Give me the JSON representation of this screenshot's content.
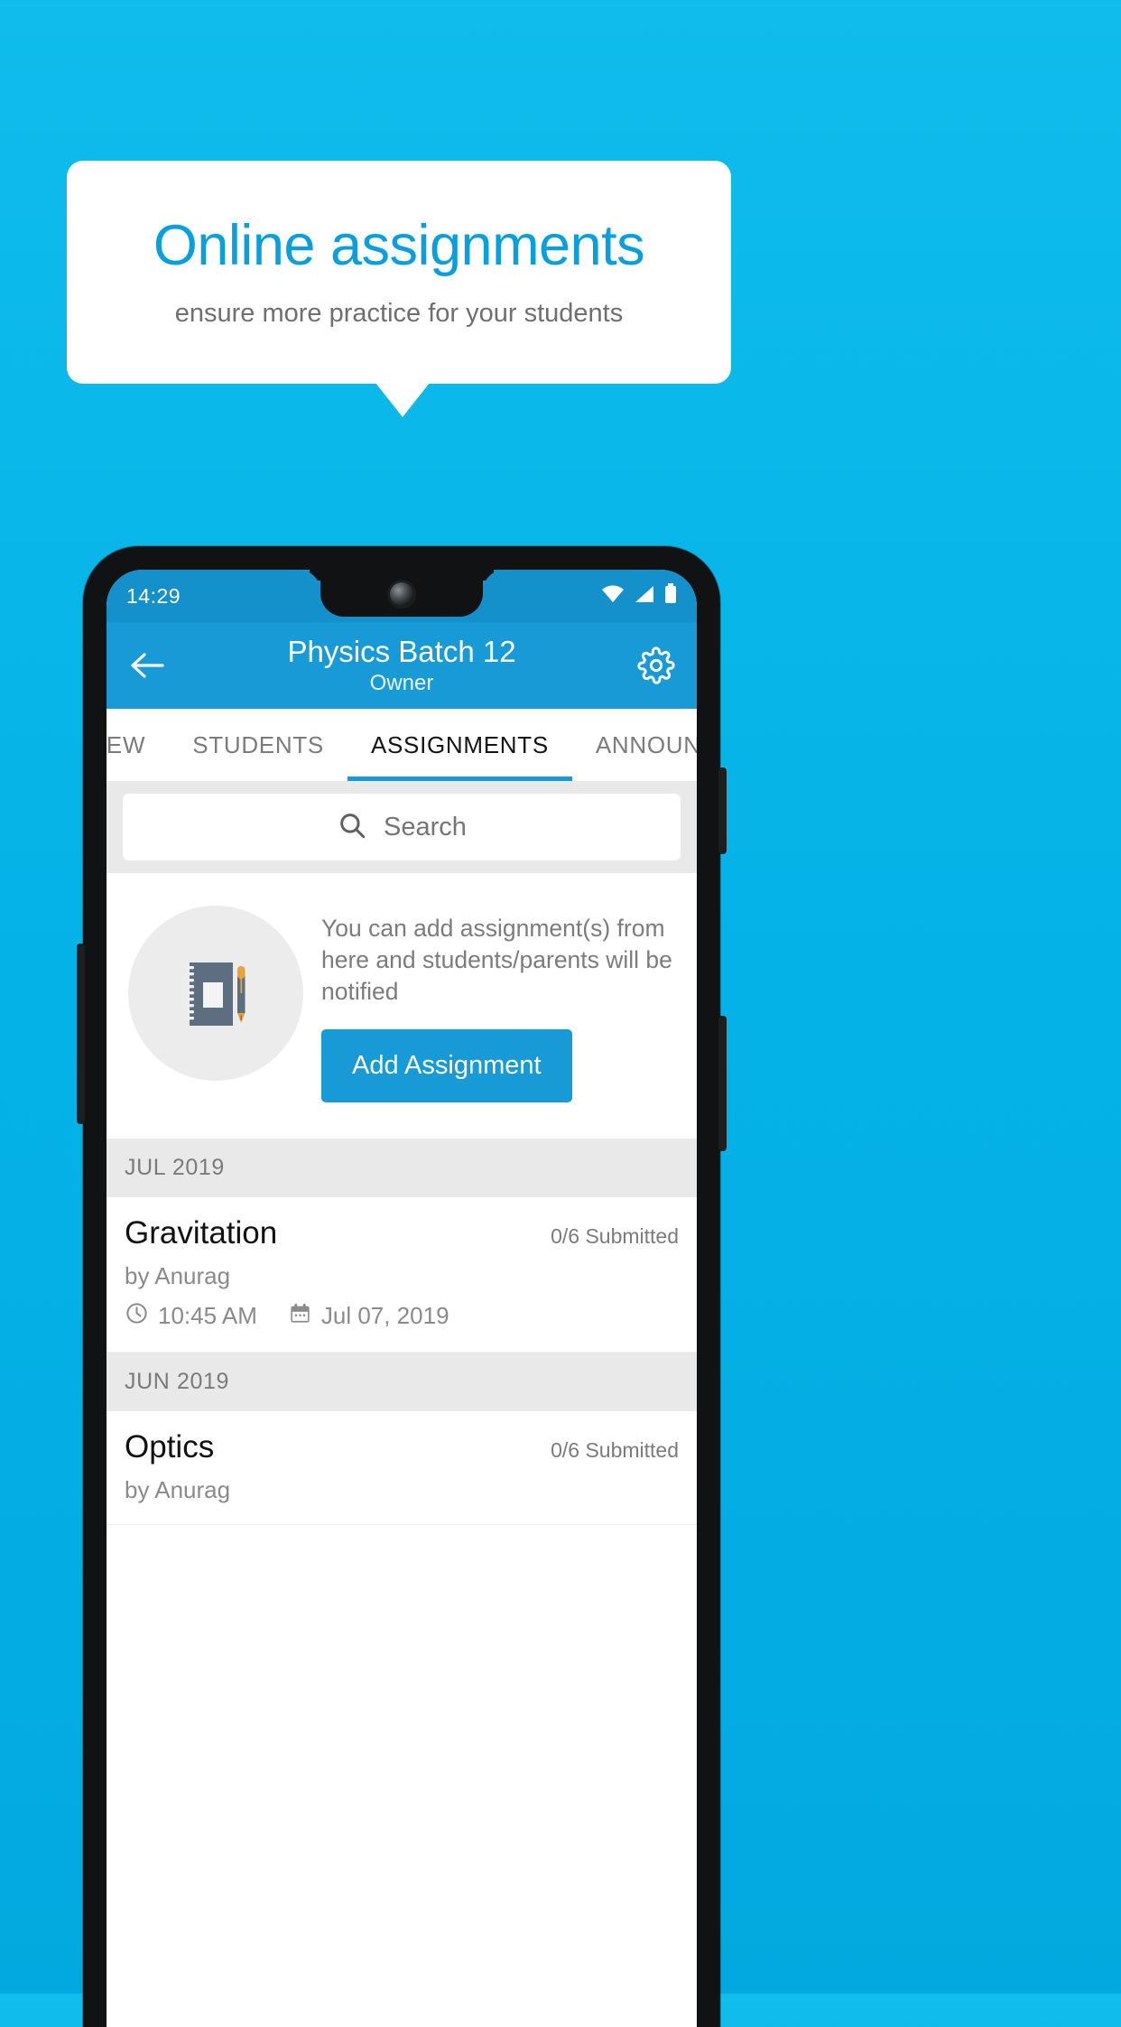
{
  "promo": {
    "title": "Online assignments",
    "subtitle": "ensure more practice for your students",
    "title_color": "#089fdd",
    "subtitle_color": "#6f6f6f",
    "background_color": "#05b3e8"
  },
  "statusbar": {
    "time": "14:29",
    "icons": [
      "wifi-icon",
      "signal-icon",
      "battery-icon"
    ]
  },
  "appbar": {
    "back_icon": "arrow-left-icon",
    "title": "Physics Batch 12",
    "subtitle": "Owner",
    "settings_icon": "gear-icon",
    "color": "#189ad6"
  },
  "tabs": [
    {
      "label": "IEW",
      "active": false
    },
    {
      "label": "STUDENTS",
      "active": false
    },
    {
      "label": "ASSIGNMENTS",
      "active": true
    },
    {
      "label": "ANNOUNCEM",
      "active": false
    }
  ],
  "search": {
    "placeholder": "Search",
    "value": "",
    "icon": "search-icon"
  },
  "empty_state": {
    "illustration": "notebook-pen-icon",
    "message": "You can add assignment(s) from here and students/parents will be notified",
    "button_label": "Add Assignment"
  },
  "assignment_groups": [
    {
      "month": "JUL 2019",
      "items": [
        {
          "title": "Gravitation",
          "submitted": "0/6 Submitted",
          "author": "by Anurag",
          "time": "10:45 AM",
          "date": "Jul 07, 2019",
          "time_icon": "clock-icon",
          "date_icon": "calendar-icon"
        }
      ]
    },
    {
      "month": "JUN 2019",
      "items": [
        {
          "title": "Optics",
          "submitted": "0/6 Submitted",
          "author": "by Anurag",
          "time": "",
          "date": "",
          "time_icon": "clock-icon",
          "date_icon": "calendar-icon"
        }
      ]
    }
  ]
}
